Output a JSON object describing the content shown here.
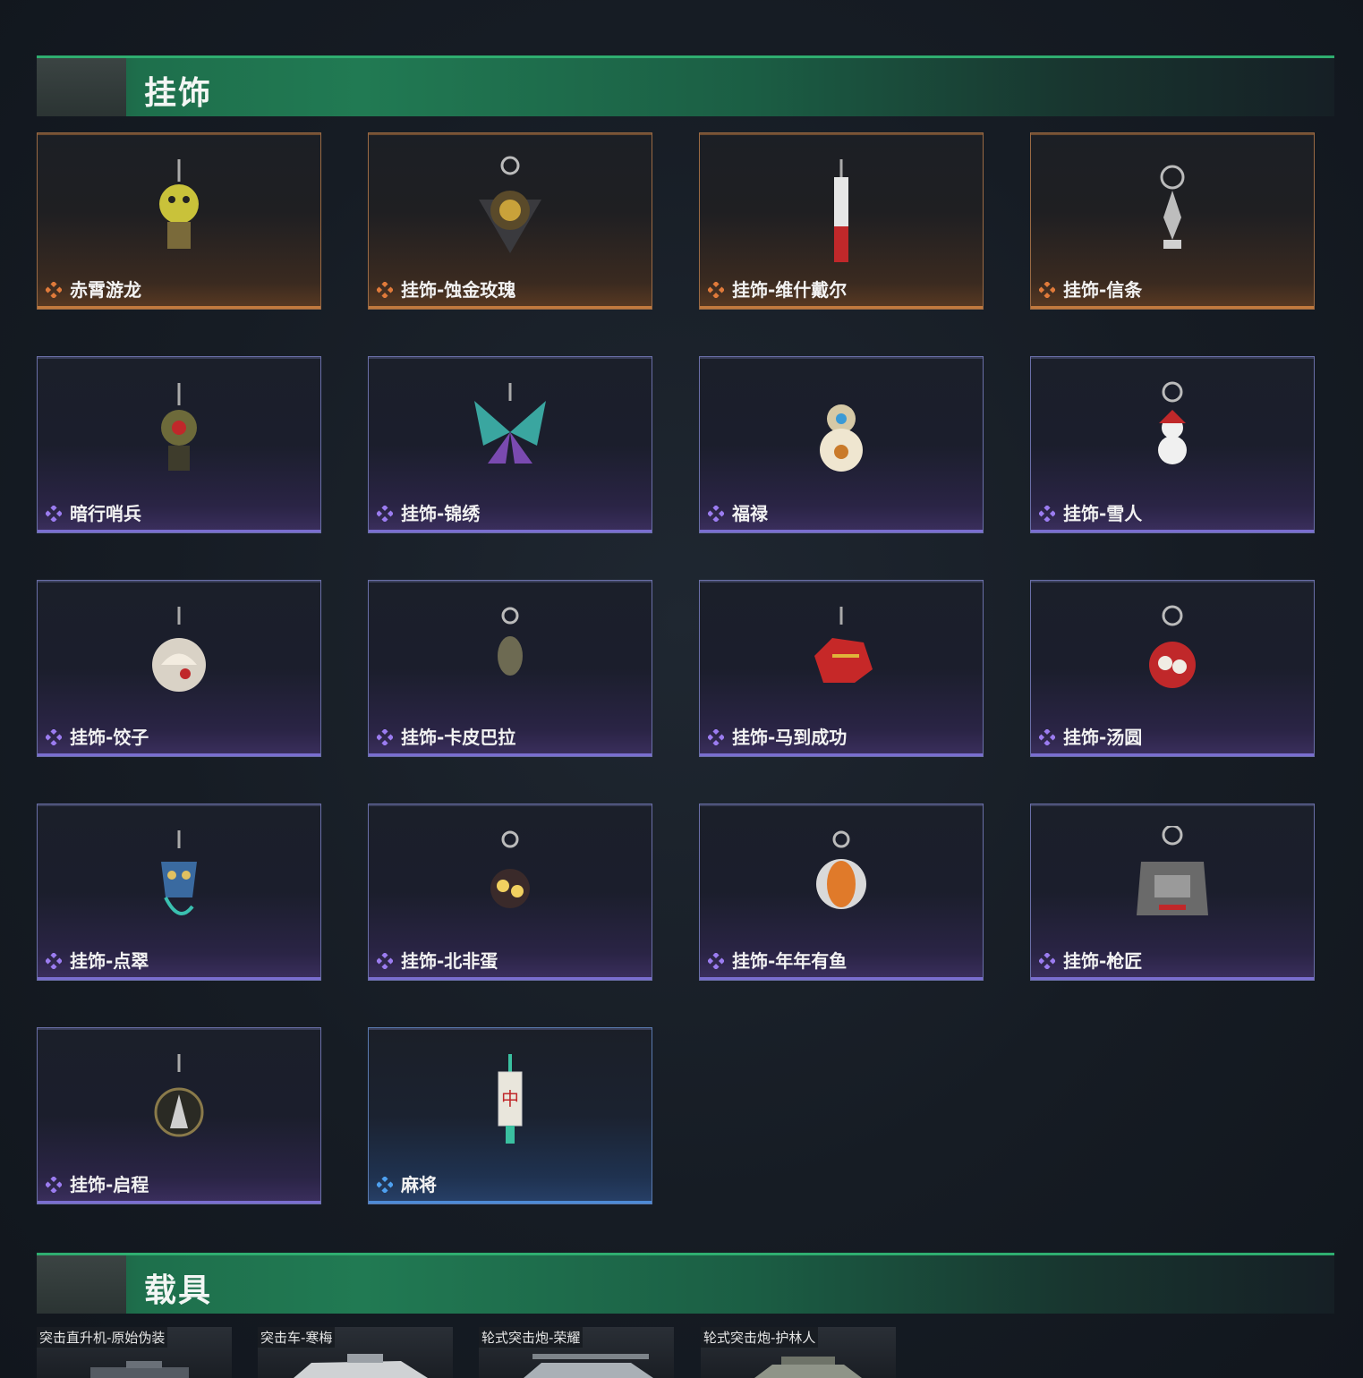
{
  "sections": {
    "charms_title": "挂饰",
    "vehicles_title": "载具"
  },
  "colors": {
    "header_green": "#217a53",
    "gold_border": "#c27a3e",
    "purple_border": "#7a6ed0",
    "blue_border": "#4d8ad6",
    "gold_icon": "#e07a3a",
    "purple_icon": "#9b7cf0",
    "blue_icon": "#4ea0f0"
  },
  "items": [
    {
      "label": "赤霄游龙",
      "rarity": "gold",
      "icon": "dragon-charm-icon"
    },
    {
      "label": "挂饰-蚀金玫瑰",
      "rarity": "gold",
      "icon": "rose-charm-icon"
    },
    {
      "label": "挂饰-维什戴尔",
      "rarity": "gold",
      "icon": "blade-charm-icon"
    },
    {
      "label": "挂饰-信条",
      "rarity": "gold",
      "icon": "creed-charm-icon"
    },
    {
      "label": "暗行哨兵",
      "rarity": "purple",
      "icon": "sentinel-charm-icon"
    },
    {
      "label": "挂饰-锦绣",
      "rarity": "purple",
      "icon": "butterfly-charm-icon"
    },
    {
      "label": "福禄",
      "rarity": "purple",
      "icon": "gourd-charm-icon"
    },
    {
      "label": "挂饰-雪人",
      "rarity": "purple",
      "icon": "snowman-charm-icon"
    },
    {
      "label": "挂饰-饺子",
      "rarity": "purple",
      "icon": "dumpling-charm-icon"
    },
    {
      "label": "挂饰-卡皮巴拉",
      "rarity": "purple",
      "icon": "capybara-charm-icon"
    },
    {
      "label": "挂饰-马到成功",
      "rarity": "purple",
      "icon": "horse-charm-icon"
    },
    {
      "label": "挂饰-汤圆",
      "rarity": "purple",
      "icon": "tangyuan-charm-icon"
    },
    {
      "label": "挂饰-点翠",
      "rarity": "purple",
      "icon": "mask-charm-icon"
    },
    {
      "label": "挂饰-北非蛋",
      "rarity": "purple",
      "icon": "shakshuka-charm-icon"
    },
    {
      "label": "挂饰-年年有鱼",
      "rarity": "purple",
      "icon": "fish-charm-icon"
    },
    {
      "label": "挂饰-枪匠",
      "rarity": "purple",
      "icon": "gunsmith-vest-charm-icon"
    },
    {
      "label": "挂饰-启程",
      "rarity": "purple",
      "icon": "medallion-charm-icon"
    },
    {
      "label": "麻将",
      "rarity": "blue",
      "icon": "mahjong-charm-icon"
    }
  ],
  "vehicles": [
    {
      "label": "突击直升机-原始伪装"
    },
    {
      "label": "突击车-寒梅"
    },
    {
      "label": "轮式突击炮-荣耀"
    },
    {
      "label": "轮式突击炮-护林人"
    }
  ]
}
